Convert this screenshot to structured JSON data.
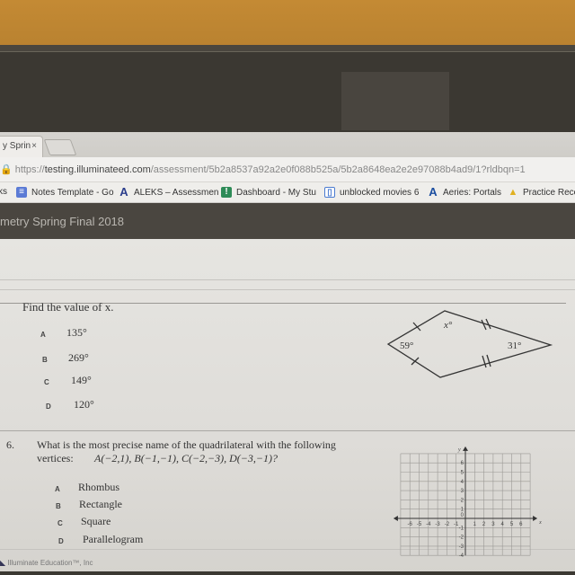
{
  "browser": {
    "tab": {
      "title": "y Sprin",
      "close": "×"
    },
    "url": {
      "scheme": "https://",
      "host": "testing.illuminateed.com",
      "path": "/assessment/5b2a8537a92a2e0f088b525a/5b2a8648ea2e2e97088b4ad9/1?rldbqn=1"
    },
    "bookmarks": [
      {
        "label": "ks",
        "icon": "apps-icon"
      },
      {
        "label": "Notes Template - Go",
        "icon": "docs-icon",
        "color": "#5b7bd5"
      },
      {
        "label": "ALEKS – Assessmen",
        "icon": "aleks-icon",
        "color": "#2c3e8c"
      },
      {
        "label": "Dashboard - My Stu",
        "icon": "dashboard-icon",
        "color": "#2e8b57"
      },
      {
        "label": "unblocked movies 6",
        "icon": "page-icon",
        "color": "#4a7bd0"
      },
      {
        "label": "Aeries: Portals",
        "icon": "aeries-icon",
        "color": "#1c4ea0"
      },
      {
        "label": "Practice Reco",
        "icon": "drive-icon"
      }
    ]
  },
  "app": {
    "title": "metry Spring Final 2018"
  },
  "question5": {
    "prompt": "Find the value of x.",
    "options": [
      {
        "letter": "A",
        "text": "135°"
      },
      {
        "letter": "B",
        "text": "269°"
      },
      {
        "letter": "C",
        "text": "149°"
      },
      {
        "letter": "D",
        "text": "120°"
      }
    ],
    "figure": {
      "type": "kite",
      "labels": {
        "top": "x°",
        "left": "59°",
        "right": "31°"
      },
      "tick_marks": {
        "left_sides": "single",
        "right_sides": "double"
      }
    }
  },
  "question6": {
    "number": "6.",
    "prompt_line1": "What is the most precise name of the quadrilateral with the following",
    "prompt_line2_label": "vertices:",
    "prompt_line2_vertices": "A(−2,1), B(−1,−1), C(−2,−3), D(−3,−1)?",
    "options": [
      {
        "letter": "A",
        "text": "Rhombus"
      },
      {
        "letter": "B",
        "text": "Rectangle"
      },
      {
        "letter": "C",
        "text": "Square"
      },
      {
        "letter": "D",
        "text": "Parallelogram"
      }
    ],
    "grid": {
      "x_label": "x",
      "y_label": "y",
      "x_ticks": [
        "-6",
        "-5",
        "-4",
        "-3",
        "-2",
        "-1",
        "1",
        "2",
        "3",
        "4",
        "5",
        "6"
      ],
      "y_ticks": [
        "6",
        "5",
        "4",
        "3",
        "2",
        "1",
        "-1",
        "-2",
        "-3",
        "-4"
      ],
      "origin_label": "0",
      "x_range": [
        -7,
        7
      ],
      "y_range": [
        -4,
        7
      ]
    }
  },
  "footer": {
    "text": "Illuminate Education™, Inc"
  }
}
